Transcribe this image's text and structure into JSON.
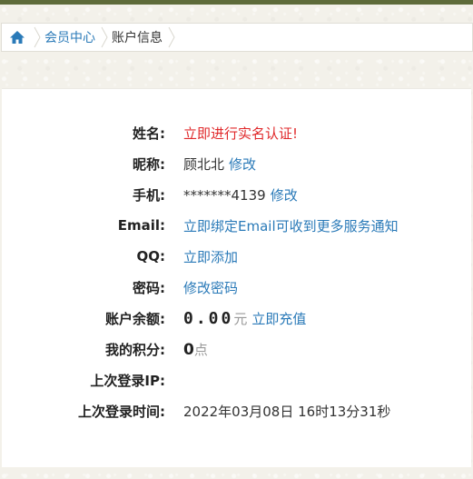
{
  "breadcrumb": {
    "home_icon": "home-icon",
    "items": [
      "会员中心",
      "账户信息"
    ]
  },
  "profile": {
    "name": {
      "label": "姓名:",
      "action": "立即进行实名认证!"
    },
    "nickname": {
      "label": "昵称:",
      "value": "顾北北",
      "action": "修改"
    },
    "phone": {
      "label": "手机:",
      "value": "*******4139",
      "action": "修改"
    },
    "email": {
      "label": "Email:",
      "action": "立即绑定Email可收到更多服务通知"
    },
    "qq": {
      "label": "QQ:",
      "action": "立即添加"
    },
    "password": {
      "label": "密码:",
      "action": "修改密码"
    },
    "balance": {
      "label": "账户余额:",
      "value": "0.00",
      "unit": "元",
      "action": "立即充值"
    },
    "points": {
      "label": "我的积分:",
      "value": "0",
      "unit": "点"
    },
    "last_ip": {
      "label": "上次登录IP:",
      "value": ""
    },
    "last_login": {
      "label": "上次登录时间:",
      "value": "2022年03月08日 16时13分31秒"
    }
  },
  "colors": {
    "link": "#2a7ab8",
    "alert": "#e0292b",
    "top_strip": "#5e6b3a"
  }
}
